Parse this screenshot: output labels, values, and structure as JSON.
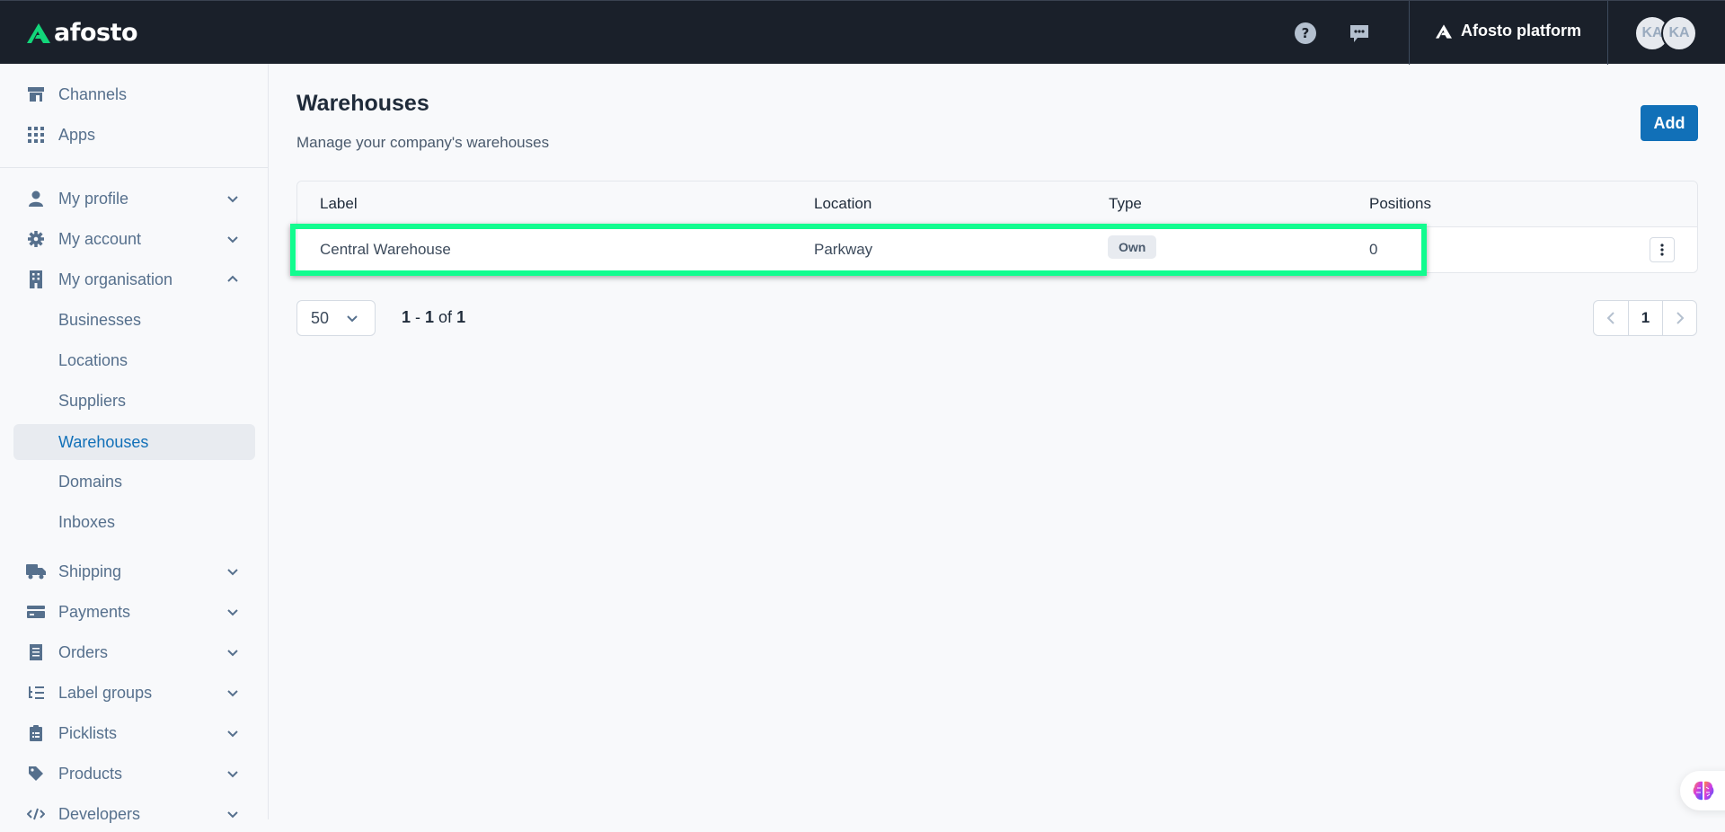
{
  "topbar": {
    "brand": "afosto",
    "platform_label": "Afosto platform",
    "help_icon": "question-circle-icon",
    "chat_icon": "chat-bubble-icon",
    "avatars": [
      "KA",
      "KA"
    ],
    "brand_color": "#12d67a"
  },
  "sidebar": {
    "top_items": [
      {
        "label": "Channels",
        "icon": "store-icon"
      },
      {
        "label": "Apps",
        "icon": "grid-icon"
      }
    ],
    "groups": [
      {
        "label": "My profile",
        "icon": "user-icon",
        "expanded": false
      },
      {
        "label": "My account",
        "icon": "gear-icon",
        "expanded": false
      },
      {
        "label": "My organisation",
        "icon": "building-icon",
        "expanded": true,
        "children": [
          "Businesses",
          "Locations",
          "Suppliers",
          "Warehouses",
          "Domains",
          "Inboxes"
        ],
        "active_child": "Warehouses"
      },
      {
        "label": "Shipping",
        "icon": "truck-icon",
        "expanded": false
      },
      {
        "label": "Payments",
        "icon": "credit-card-icon",
        "expanded": false
      },
      {
        "label": "Orders",
        "icon": "receipt-icon",
        "expanded": false
      },
      {
        "label": "Label groups",
        "icon": "list-tree-icon",
        "expanded": false
      },
      {
        "label": "Picklists",
        "icon": "clipboard-list-icon",
        "expanded": false
      },
      {
        "label": "Products",
        "icon": "tag-icon",
        "expanded": false
      },
      {
        "label": "Developers",
        "icon": "code-icon",
        "expanded": false
      }
    ]
  },
  "main": {
    "title": "Warehouses",
    "subtitle": "Manage your company's warehouses",
    "add_label": "Add",
    "accent_color": "#1170b8",
    "table": {
      "columns": [
        "Label",
        "Location",
        "Type",
        "Positions"
      ],
      "rows": [
        {
          "label": "Central Warehouse",
          "location": "Parkway",
          "type": "Own",
          "positions": "0"
        }
      ]
    },
    "pagination": {
      "per_page": "50",
      "range_start": "1",
      "range_end": "1",
      "of_label": "of",
      "total": "1",
      "current_page": "1"
    },
    "highlight_color": "#12fc8f"
  }
}
